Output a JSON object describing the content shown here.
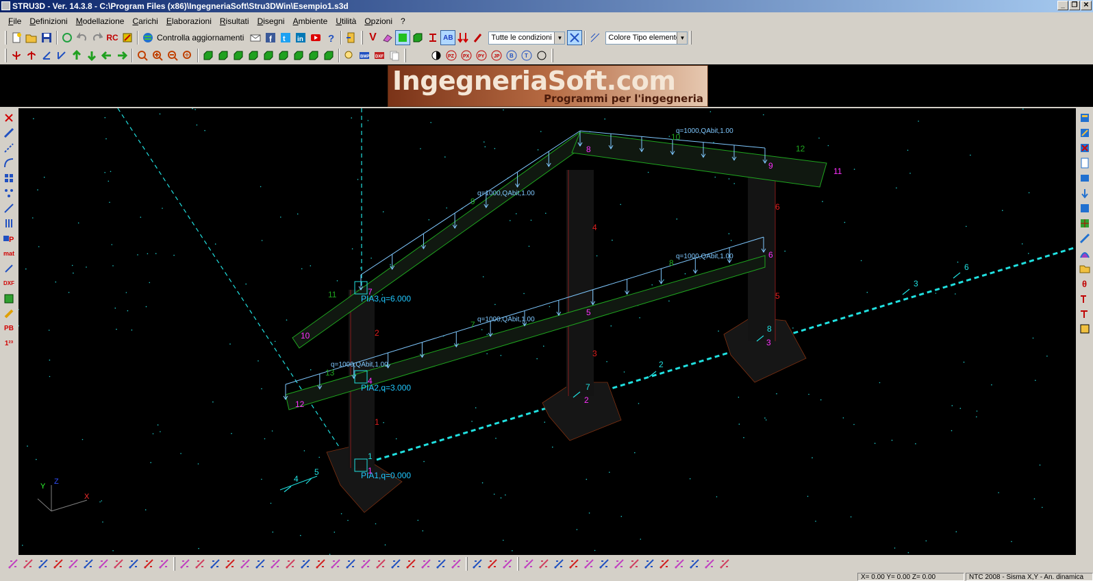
{
  "window": {
    "title": "STRU3D - Ver. 14.3.8 - C:\\Program Files (x86)\\IngegneriaSoft\\Stru3DWin\\Esempio1.s3d",
    "btn_min": "_",
    "btn_restore": "❐",
    "btn_close": "✕"
  },
  "menu": [
    "File",
    "Definizioni",
    "Modellazione",
    "Carichi",
    "Elaborazioni",
    "Risultati",
    "Disegni",
    "Ambiente",
    "Utilità",
    "Opzioni",
    "?"
  ],
  "toolbar": {
    "rc_label": "RC",
    "updates_label": "Controlla aggiornamenti",
    "v_label": "V",
    "ab_label": "AB",
    "conditions_select": "Tutte le condizioni",
    "color_select": "Colore Tipo elemento"
  },
  "banner": {
    "logo_main": "IngegneriaSoft.com",
    "logo_sub": "Programmi per l'ingegneria"
  },
  "leftbar": {
    "dxf": "DXF",
    "pb": "PB",
    "num": "1²³",
    "mat": "mat"
  },
  "drawing": {
    "plan_labels": {
      "pia1": "PIA1,q=0.000",
      "pia2": "PIA2,q=3.000",
      "pia3": "PIA3,q=6.000"
    },
    "load_label": "q=1000,QAbit,1.00",
    "node_labels": [
      "1",
      "2",
      "3",
      "4",
      "5",
      "6",
      "7",
      "8",
      "9",
      "10",
      "11",
      "12"
    ],
    "beam_labels": [
      "7",
      "8",
      "9",
      "10",
      "11",
      "12",
      "13"
    ],
    "column_labels": [
      "1",
      "2",
      "3",
      "4",
      "5",
      "6"
    ],
    "axis_labels": [
      "1",
      "2",
      "3",
      "4",
      "5",
      "6",
      "7",
      "8"
    ],
    "axes_triad": {
      "x": "X",
      "y": "Y",
      "z": "Z"
    }
  },
  "status": {
    "coords": "X= 0.00  Y= 0.00  Z= 0.00",
    "norm": "NTC 2008 - Sisma X,Y - An. dinamica"
  },
  "colors": {
    "beam": "#1fa81f",
    "load": "#7fc8ff",
    "node": "#ff30ff",
    "column_label": "#e02020",
    "axis": "#20e0e0",
    "foundation": "#1a1a1a"
  }
}
